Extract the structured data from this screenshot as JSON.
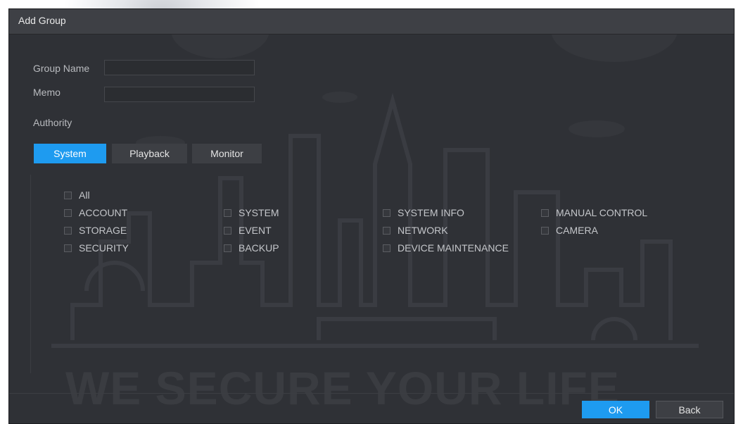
{
  "dialog": {
    "title": "Add Group"
  },
  "form": {
    "group_name_label": "Group Name",
    "group_name_value": "",
    "memo_label": "Memo",
    "memo_value": "",
    "authority_label": "Authority"
  },
  "tabs": [
    {
      "label": "System",
      "active": true
    },
    {
      "label": "Playback",
      "active": false
    },
    {
      "label": "Monitor",
      "active": false
    }
  ],
  "permissions": {
    "all": {
      "label": "All",
      "checked": false
    },
    "items": [
      {
        "label": "ACCOUNT",
        "checked": false
      },
      {
        "label": "STORAGE",
        "checked": false
      },
      {
        "label": "SECURITY",
        "checked": false
      },
      {
        "label": "SYSTEM",
        "checked": false
      },
      {
        "label": "EVENT",
        "checked": false
      },
      {
        "label": "BACKUP",
        "checked": false
      },
      {
        "label": "SYSTEM INFO",
        "checked": false
      },
      {
        "label": "NETWORK",
        "checked": false
      },
      {
        "label": "DEVICE MAINTENANCE",
        "checked": false
      },
      {
        "label": "MANUAL CONTROL",
        "checked": false
      },
      {
        "label": "CAMERA",
        "checked": false
      }
    ]
  },
  "watermark": {
    "text": "WE SECURE YOUR LIFE"
  },
  "buttons": {
    "ok_label": "OK",
    "back_label": "Back"
  },
  "colors": {
    "accent": "#1e9bf0",
    "background": "#2f3136"
  }
}
